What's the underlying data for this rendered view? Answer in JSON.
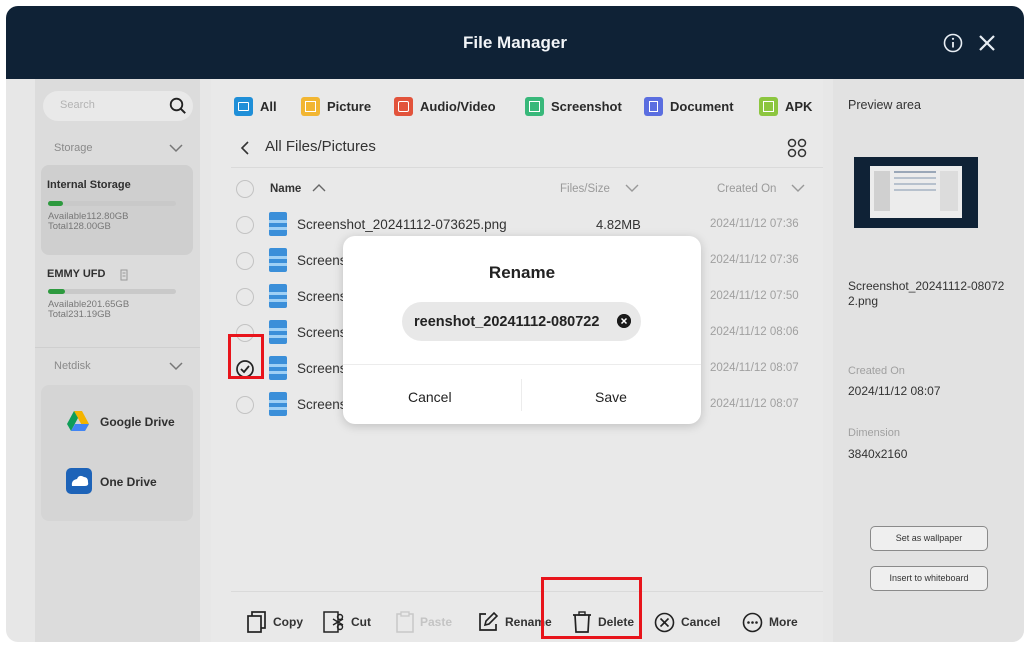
{
  "window": {
    "title": "File Manager",
    "info_icon": "info-icon",
    "close_icon": "close-icon"
  },
  "sidebar": {
    "search_placeholder": "Search",
    "storage_section": "Storage",
    "internal_storage": {
      "name": "Internal Storage",
      "available": "Available112.80GB",
      "total": "Total128.00GB",
      "used_fraction": 0.12
    },
    "usb": {
      "name": "EMMY UFD",
      "available": "Available201.65GB",
      "total": "Total231.19GB",
      "used_fraction": 0.13
    },
    "netdisk_section": "Netdisk",
    "drives": [
      {
        "label": "Google Drive",
        "icon": "google-drive-icon"
      },
      {
        "label": "One Drive",
        "icon": "onedrive-icon"
      }
    ]
  },
  "categories": [
    {
      "label": "All",
      "color": "#1f8fd8"
    },
    {
      "label": "Picture",
      "color": "#f2b632"
    },
    {
      "label": "Audio/Video",
      "color": "#e2533b"
    },
    {
      "label": "Screenshot",
      "color": "#38b87a"
    },
    {
      "label": "Document",
      "color": "#5b6ee0"
    },
    {
      "label": "APK",
      "color": "#8cc63f"
    }
  ],
  "breadcrumb": "All Files/Pictures",
  "columns": {
    "name": "Name",
    "size": "Files/Size",
    "created": "Created On"
  },
  "files": [
    {
      "name": "Screenshot_20241112-073625.png",
      "size": "4.82MB",
      "date": "2024/11/12 07:36"
    },
    {
      "name": "Screens",
      "size": "",
      "date": "2024/11/12 07:36"
    },
    {
      "name": "Screens",
      "size": "",
      "date": "2024/11/12 07:50"
    },
    {
      "name": "Screens",
      "size": "",
      "date": "2024/11/12 08:06"
    },
    {
      "name": "Screens",
      "size": "",
      "date": "2024/11/12 08:07"
    },
    {
      "name": "Screens",
      "size": "",
      "date": "2024/11/12 08:07"
    }
  ],
  "actions": {
    "copy": "Copy",
    "cut": "Cut",
    "paste": "Paste",
    "rename": "Rename",
    "delete": "Delete",
    "cancel": "Cancel",
    "more": "More"
  },
  "preview": {
    "title": "Preview area",
    "filename": "Screenshot_20241112-080722.png",
    "created_label": "Created On",
    "created_value": "2024/11/12 08:07",
    "dimension_label": "Dimension",
    "dimension_value": "3840x2160",
    "set_wallpaper": "Set as wallpaper",
    "insert_whiteboard": "Insert to whiteboard"
  },
  "dialog": {
    "title": "Rename",
    "input_value": "reenshot_20241112-080722",
    "cancel": "Cancel",
    "save": "Save"
  },
  "colors": {
    "titlebar": "#0f2236",
    "highlight": "#e8141b",
    "file_icon": "#3b8fd9"
  }
}
